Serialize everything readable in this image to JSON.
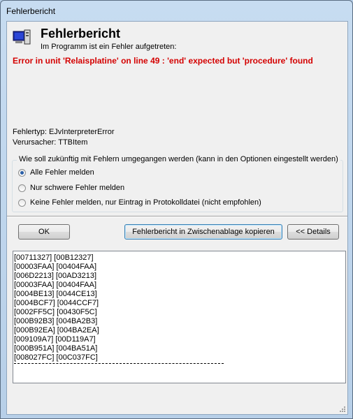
{
  "window": {
    "title": "Fehlerbericht"
  },
  "header": {
    "heading": "Fehlerbericht",
    "subheading": "Im Programm ist ein Fehler aufgetreten:",
    "error_message": "Error in unit 'Relaisplatine' on line 49 : 'end' expected but 'procedure' found",
    "error_color": "#d40000",
    "error_type": "Fehlertyp: EJvInterpreterError",
    "cause": "Verursacher: TTBItem"
  },
  "options": {
    "group_label": "Wie soll zukünftig mit Fehlern umgegangen werden (kann in den Optionen eingestellt werden)",
    "radios": [
      {
        "label": "Alle Fehler melden",
        "checked": true
      },
      {
        "label": "Nur schwere Fehler melden",
        "checked": false
      },
      {
        "label": "Keine Fehler melden, nur Eintrag in Protokolldatei (nicht empfohlen)",
        "checked": false
      }
    ]
  },
  "buttons": {
    "ok": "OK",
    "copy": "Fehlerbericht in Zwischenablage kopieren",
    "details": "<< Details"
  },
  "log": {
    "lines": [
      "[00711327] [00B12327]",
      "[00003FAA] [00404FAA]",
      "[006D2213] [00AD3213]",
      "[00003FAA] [00404FAA]",
      "[0004BE13] [0044CE13]",
      "[0004BCF7] [0044CCF7]",
      "[0002FF5C] [00430F5C]",
      "[000B92B3] [004BA2B3]",
      "[000B92EA] [004BA2EA]",
      "[009109A7] [00D119A7]",
      "[000B951A] [004BA51A]",
      "[008027FC] [00C037FC]"
    ]
  },
  "icons": {
    "app_icon": "computer-monitor-icon"
  }
}
